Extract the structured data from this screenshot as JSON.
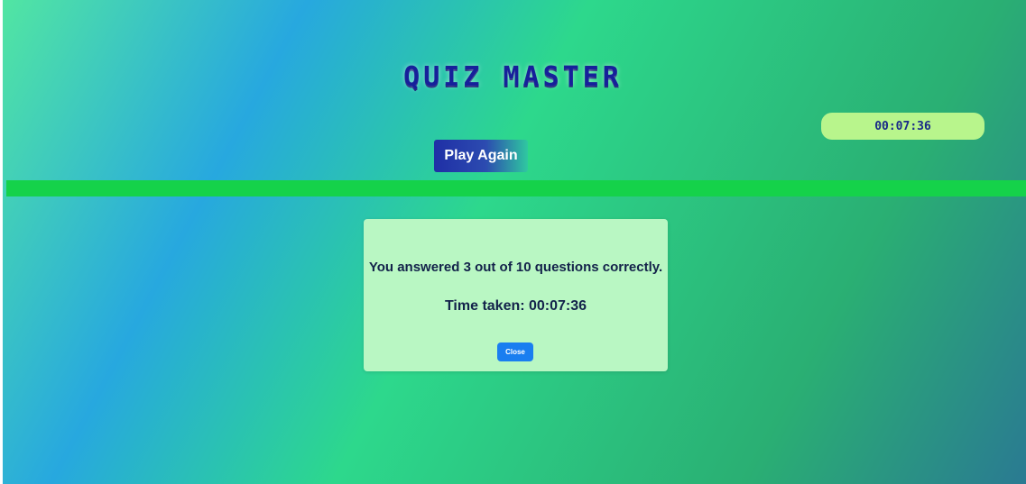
{
  "header": {
    "title": "QUIZ MASTER",
    "timer": "00:07:36",
    "play_again_label": "Play Again"
  },
  "progress": {
    "fraction": 1.0
  },
  "modal": {
    "score_text": "You answered 3 out of 10 questions correctly.",
    "time_text": "Time taken: 00:07:36",
    "close_label": "Close"
  },
  "colors": {
    "title": "#16209a",
    "timer_bg": "#b8f58c",
    "progress": "#18d64d",
    "modal_bg": "#b9f7c3",
    "close_button": "#1a7ef0"
  }
}
